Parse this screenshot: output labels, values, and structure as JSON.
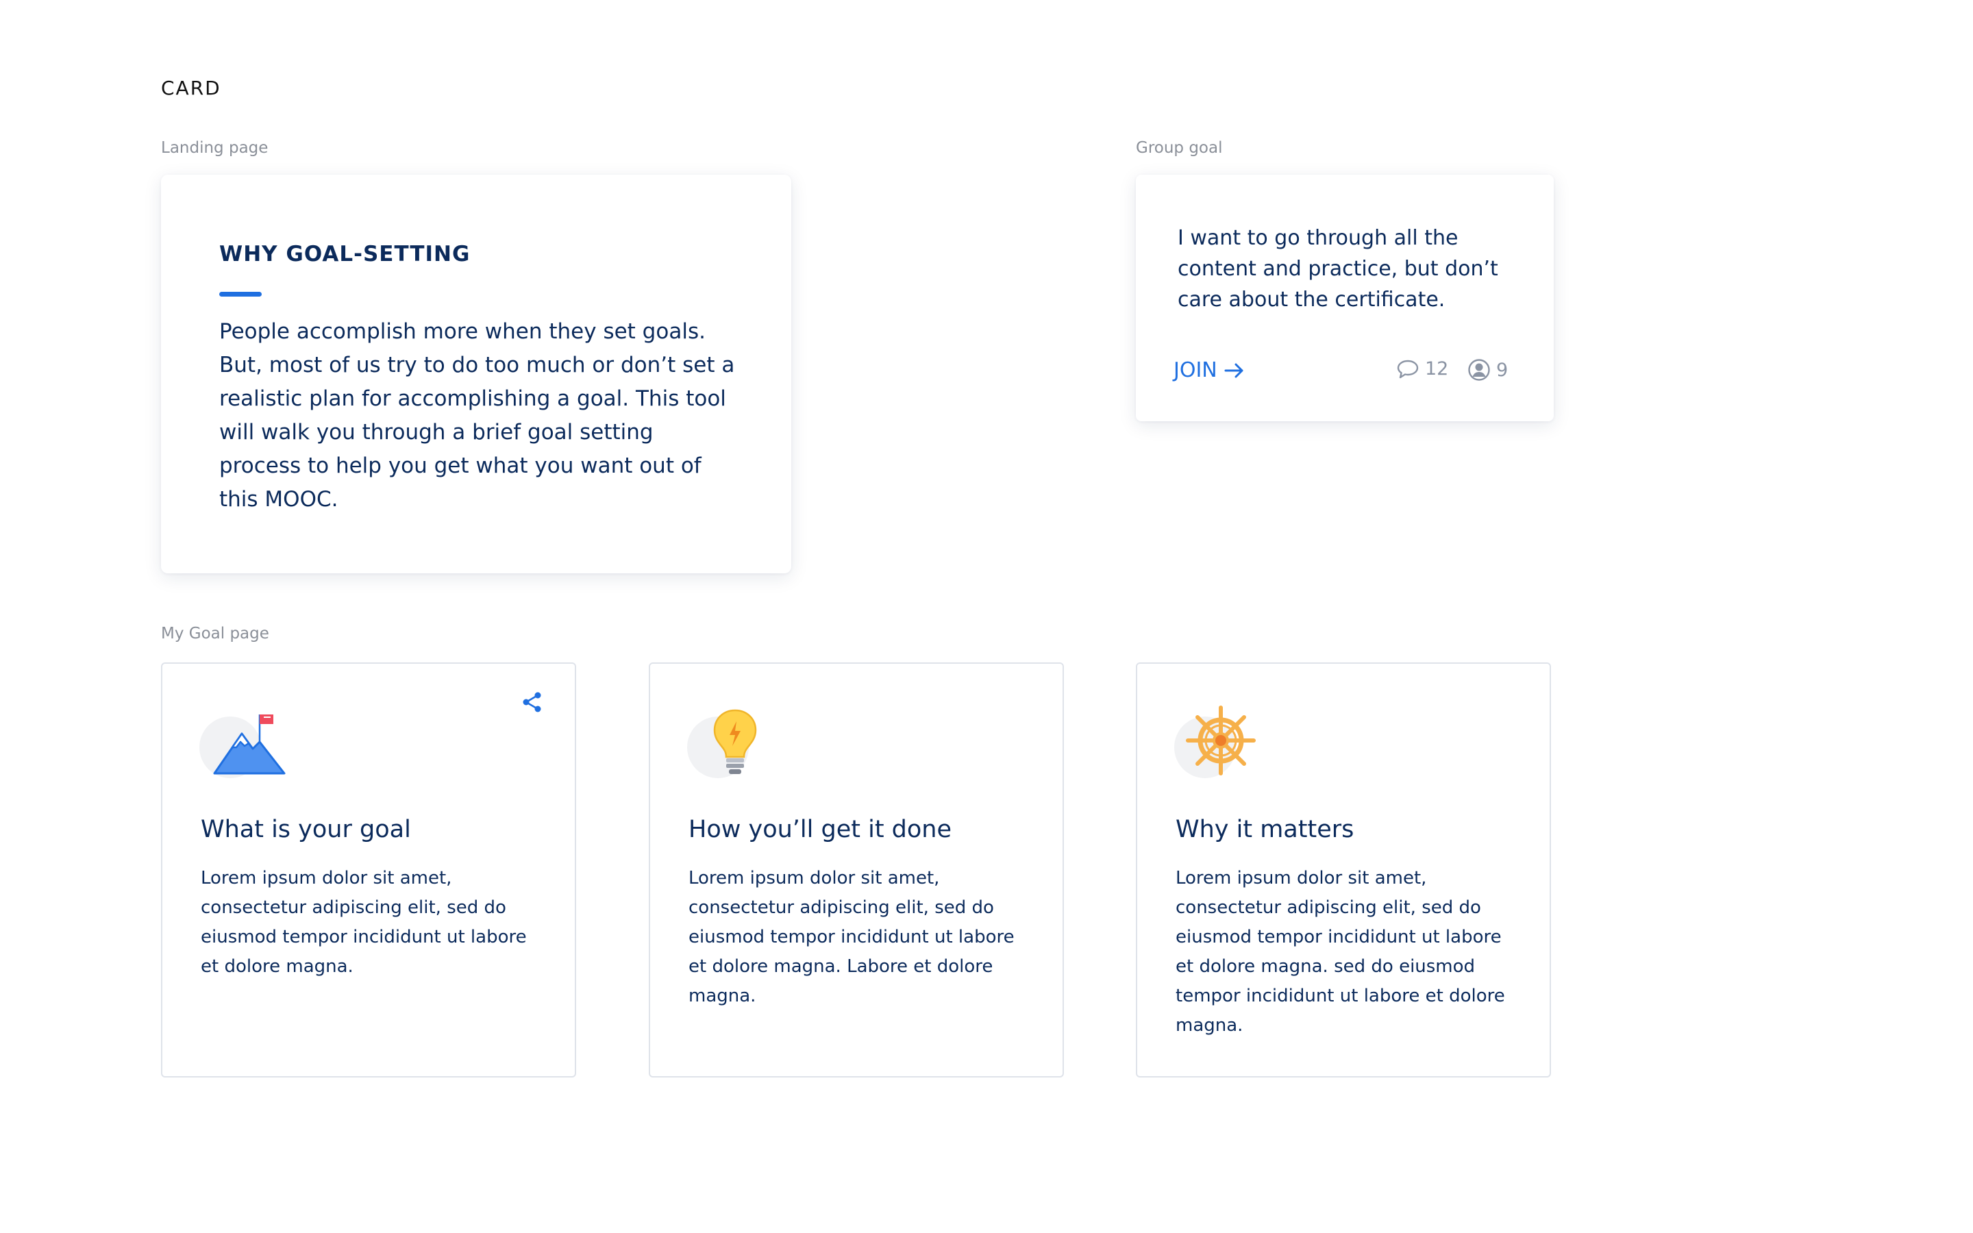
{
  "page": {
    "title": "CARD"
  },
  "sections": {
    "landing": "Landing page",
    "group": "Group goal",
    "my_goal": "My Goal page"
  },
  "landing_card": {
    "heading": "WHY GOAL-SETTING",
    "body": "People accomplish more when they set goals. But, most of us try to do too much or don’t set a realistic plan for accomplishing a goal. This tool will walk you through a brief goal setting process to help you get what you want out of this MOOC."
  },
  "group_card": {
    "quote": "I want to go through all the content and practice, but don’t care about the certificate.",
    "join_label": "JOIN",
    "comments_count": "12",
    "members_count": "9"
  },
  "goal_cards": [
    {
      "title": "What is your goal",
      "text": "Lorem ipsum dolor sit amet, consectetur adipiscing elit, sed do eiusmod tempor incididunt ut labore et dolore magna.",
      "icon": "mountain-flag-icon"
    },
    {
      "title": "How you’ll get it done",
      "text": "Lorem ipsum dolor sit amet, consectetur adipiscing elit, sed do eiusmod tempor incididunt ut labore et dolore magna. Labore et dolore magna.",
      "icon": "lightbulb-icon"
    },
    {
      "title": "Why it matters",
      "text": "Lorem ipsum dolor sit amet, consectetur adipiscing elit, sed do eiusmod tempor incididunt ut labore et dolore magna. sed do eiusmod tempor incididunt ut labore et dolore magna.",
      "icon": "ship-wheel-icon"
    }
  ],
  "colors": {
    "navy": "#0b2a5b",
    "accent_blue": "#1f6fe0",
    "muted": "#8a8f98",
    "border": "#dfe3ea",
    "bulb_yellow": "#ffd24a",
    "wheel_orange": "#f6b04a",
    "flag_red": "#ef4b5c"
  }
}
